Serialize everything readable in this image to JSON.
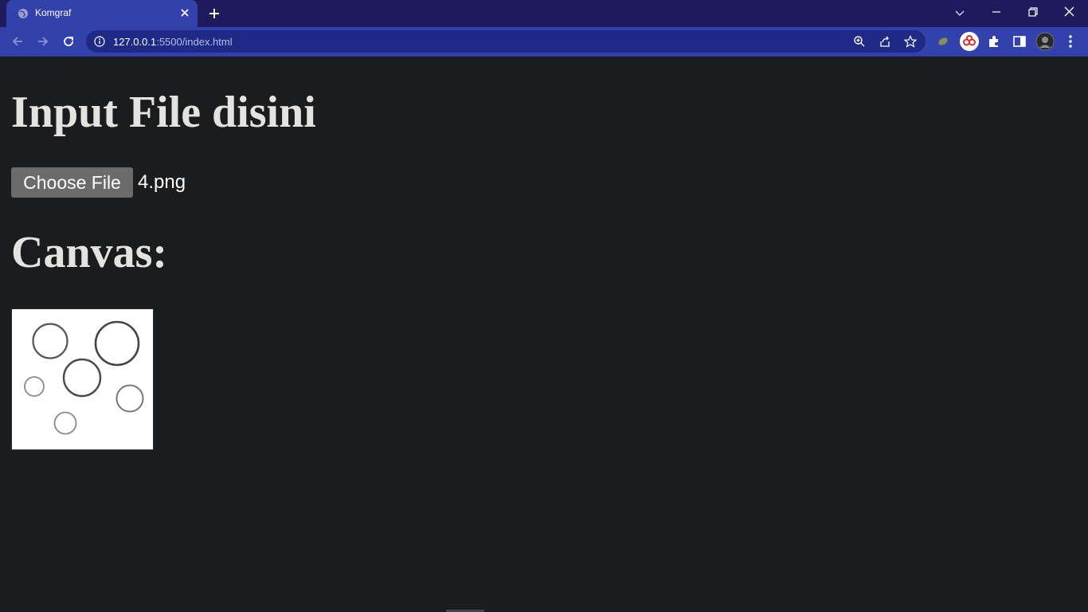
{
  "browser": {
    "tab_title": "Komgraf",
    "url_host": "127.0.0.1",
    "url_rest": ":5500/index.html",
    "accent_color": "#3341ad",
    "frame_color": "#1d1b5b"
  },
  "page": {
    "heading_input": "Input File disini",
    "file_button_label": "Choose File",
    "file_name": "4.png",
    "heading_canvas": "Canvas:"
  }
}
